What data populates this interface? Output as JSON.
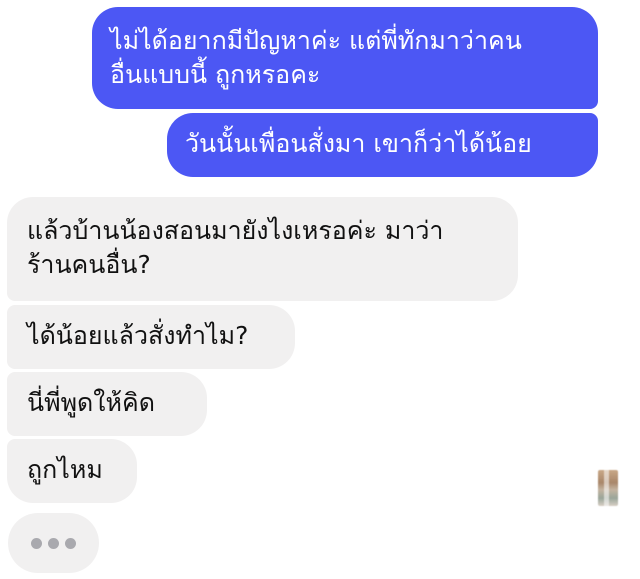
{
  "conversation": {
    "outgoing": [
      {
        "text": "ไม่ได้อยากมีปัญหาค่ะ แต่พี่ทักมาว่าคน\nอื่นแบบนี้ ถูกหรอคะ"
      },
      {
        "text": "วันนั้นเพื่อนสั่งมา เขาก็ว่าได้น้อย"
      }
    ],
    "incoming": [
      {
        "text": "แล้วบ้านน้องสอนมายังไงเหรอค่ะ มาว่า\nร้านคนอื่น?"
      },
      {
        "text": "ได้น้อยแล้วสั่งทำไม?"
      },
      {
        "text": "นี่พี่พูดให้คิด"
      },
      {
        "text": "ถูกไหม"
      }
    ],
    "typing_indicator": {
      "dots": 3
    }
  },
  "colors": {
    "outgoing_bubble": "#4c57f4",
    "incoming_bubble": "#f1f0f0",
    "typing_dot": "#a9a9ae"
  },
  "icons": {
    "avatar": "blurred-profile-avatar"
  }
}
